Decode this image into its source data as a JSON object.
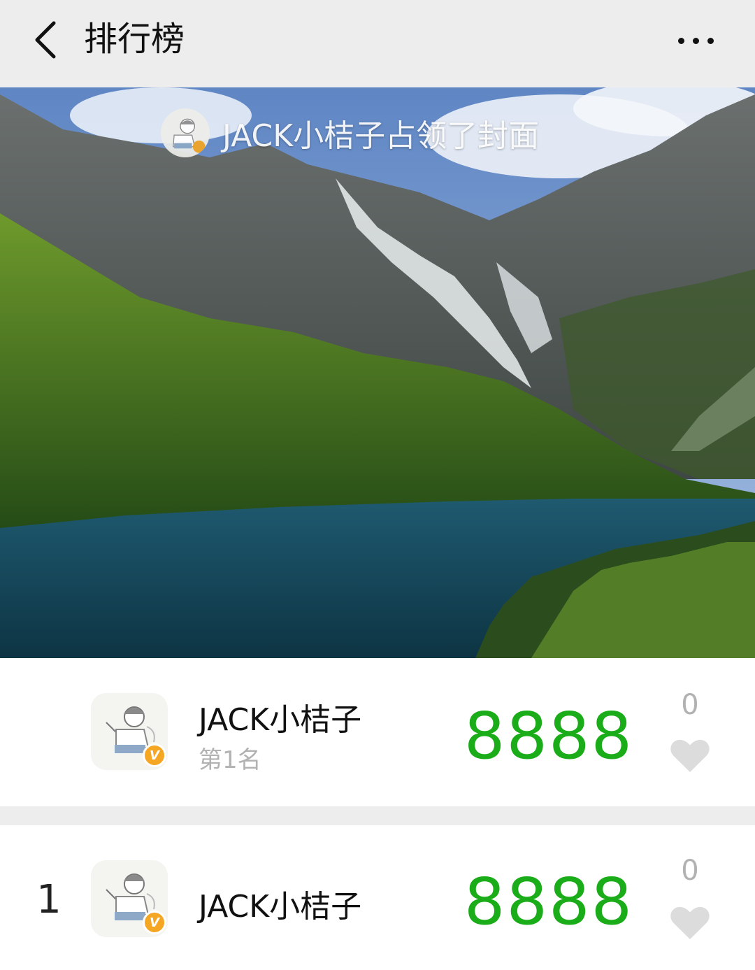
{
  "header": {
    "title": "排行榜",
    "back_icon": "chevron-left-icon",
    "more_icon": "more-dots-icon"
  },
  "cover": {
    "caption": "JACK小桔子占领了封面"
  },
  "my_rank": {
    "name": "JACK小桔子",
    "rank_text": "第1名",
    "steps": "8888",
    "likes": "0"
  },
  "leaderboard": [
    {
      "rank": "1",
      "name": "JACK小桔子",
      "steps": "8888",
      "likes": "0"
    }
  ],
  "colors": {
    "steps_green": "#1aad19",
    "muted_gray": "#b2b2b2",
    "badge_orange": "#f5a623",
    "background": "#ededed"
  }
}
